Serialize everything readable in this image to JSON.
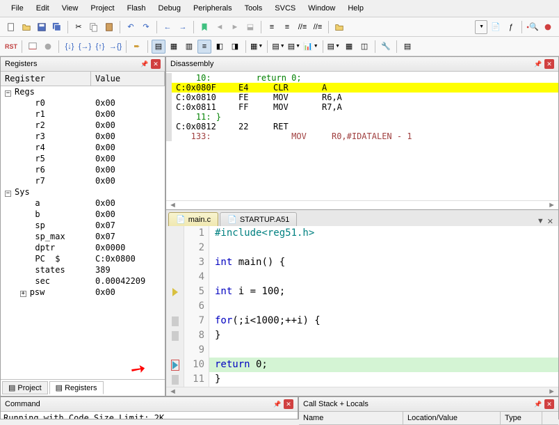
{
  "menu": [
    "File",
    "Edit",
    "View",
    "Project",
    "Flash",
    "Debug",
    "Peripherals",
    "Tools",
    "SVCS",
    "Window",
    "Help"
  ],
  "registers": {
    "title": "Registers",
    "head_name": "Register",
    "head_val": "Value",
    "groups": [
      {
        "name": "Regs",
        "open": true,
        "items": [
          {
            "n": "r0",
            "v": "0x00"
          },
          {
            "n": "r1",
            "v": "0x00"
          },
          {
            "n": "r2",
            "v": "0x00"
          },
          {
            "n": "r3",
            "v": "0x00"
          },
          {
            "n": "r4",
            "v": "0x00"
          },
          {
            "n": "r5",
            "v": "0x00"
          },
          {
            "n": "r6",
            "v": "0x00"
          },
          {
            "n": "r7",
            "v": "0x00"
          }
        ]
      },
      {
        "name": "Sys",
        "open": true,
        "items": [
          {
            "n": "a",
            "v": "0x00"
          },
          {
            "n": "b",
            "v": "0x00"
          },
          {
            "n": "sp",
            "v": "0x07"
          },
          {
            "n": "sp_max",
            "v": "0x07"
          },
          {
            "n": "dptr",
            "v": "0x0000"
          },
          {
            "n": "PC  $",
            "v": "C:0x0800"
          },
          {
            "n": "states",
            "v": "389"
          },
          {
            "n": "sec",
            "v": "0.00042209"
          },
          {
            "n": "psw",
            "v": "0x00",
            "tree": true
          }
        ]
      }
    ],
    "tabs": [
      {
        "label": "Project",
        "icon": "project-icon"
      },
      {
        "label": "Registers",
        "icon": "registers-icon",
        "active": true
      }
    ]
  },
  "disassembly": {
    "title": "Disassembly",
    "rows": [
      {
        "type": "src",
        "indent": "    ",
        "line": "10:",
        "code": "         return 0;"
      },
      {
        "type": "asm",
        "hl": true,
        "addr": "C:0x080F",
        "bytes": "E4",
        "op": "CLR",
        "args": "A"
      },
      {
        "type": "asm",
        "addr": "C:0x0810",
        "bytes": "FE",
        "op": "MOV",
        "args": "R6,A"
      },
      {
        "type": "asm",
        "addr": "C:0x0811",
        "bytes": "FF",
        "op": "MOV",
        "args": "R7,A"
      },
      {
        "type": "src",
        "indent": "    ",
        "line": "11:",
        "code": " }"
      },
      {
        "type": "asm",
        "addr": "C:0x0812",
        "bytes": "22",
        "op": "RET",
        "args": ""
      },
      {
        "type": "redsrc",
        "indent": "   ",
        "line": "133:",
        "spacer": "                ",
        "op": "MOV",
        "args": "R0,#IDATALEN - 1"
      }
    ]
  },
  "editor": {
    "tabs": [
      {
        "label": "main.c",
        "active": true
      },
      {
        "label": "STARTUP.A51"
      }
    ],
    "lines": [
      {
        "n": 1,
        "html": "<span class='pp'>#include&lt;reg51.h&gt;</span>"
      },
      {
        "n": 2,
        "html": ""
      },
      {
        "n": 3,
        "html": "<span class='kw'>int</span> main() {"
      },
      {
        "n": 4,
        "html": ""
      },
      {
        "n": 5,
        "html": "  <span class='kw'>int</span> i = 100;",
        "marker": "yellow",
        "mblock": true
      },
      {
        "n": 6,
        "html": ""
      },
      {
        "n": 7,
        "html": "  <span class='kw'>for</span>(;i&lt;1000;++i) {",
        "mblock": true
      },
      {
        "n": 8,
        "html": "  }",
        "mblock": true
      },
      {
        "n": 9,
        "html": ""
      },
      {
        "n": 10,
        "html": "  <span class='kw'>return</span> 0;",
        "marker": "cyan",
        "cur": true,
        "mblock": true
      },
      {
        "n": 11,
        "html": "}",
        "mblock": true
      }
    ]
  },
  "command": {
    "title": "Command",
    "text": "Running with Code Size Limit: 2K"
  },
  "locals": {
    "title": "Call Stack + Locals",
    "cols": [
      "Name",
      "Location/Value",
      "Type"
    ]
  }
}
